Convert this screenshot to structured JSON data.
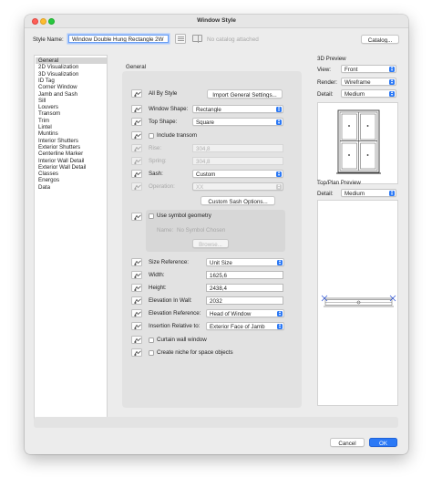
{
  "window": {
    "title": "Window Style"
  },
  "header": {
    "style_name_label": "Style Name:",
    "style_name_value": "Window Double Hung Rectangle 2W",
    "catalog_status": "No catalog attached",
    "catalog_button": "Catalog..."
  },
  "sidebar": {
    "items": [
      {
        "label": "General",
        "selected": true
      },
      {
        "label": "2D Visualization"
      },
      {
        "label": "3D Visualization"
      },
      {
        "label": "ID Tag"
      },
      {
        "label": "Corner Window"
      },
      {
        "label": "Jamb and Sash"
      },
      {
        "label": "Sill"
      },
      {
        "label": "Louvers"
      },
      {
        "label": "Transom"
      },
      {
        "label": "Trim"
      },
      {
        "label": "Lintel"
      },
      {
        "label": "Muntins"
      },
      {
        "label": "Interior Shutters"
      },
      {
        "label": "Exterior Shutters"
      },
      {
        "label": "Centerline Marker"
      },
      {
        "label": "Interior Wall Detail"
      },
      {
        "label": "Exterior Wall Detail"
      },
      {
        "label": "Classes"
      },
      {
        "label": "Energos"
      },
      {
        "label": "Data"
      }
    ]
  },
  "general": {
    "section_title": "General",
    "all_by_style_label": "All By Style",
    "import_button": "Import General Settings...",
    "window_shape_label": "Window Shape:",
    "window_shape_value": "Rectangle",
    "top_shape_label": "Top Shape:",
    "top_shape_value": "Square",
    "include_transom_label": "Include transom",
    "rise_label": "Rise:",
    "rise_value": "304,8",
    "spring_label": "Spring:",
    "spring_value": "304,8",
    "sash_label": "Sash:",
    "sash_value": "Custom",
    "operation_label": "Operation:",
    "operation_value": "XX",
    "custom_sash_button": "Custom Sash Options...",
    "use_symbol_label": "Use symbol geometry",
    "symbol_name_label": "Name:",
    "symbol_name_value": "No Symbol Chosen",
    "browse_button": "Browse...",
    "size_ref_label": "Size Reference:",
    "size_ref_value": "Unit Size",
    "width_label": "Width:",
    "width_value": "1625,6",
    "height_label": "Height:",
    "height_value": "2438,4",
    "elevation_label": "Elevation In Wall:",
    "elevation_value": "2032",
    "elevation_ref_label": "Elevation Reference:",
    "elevation_ref_value": "Head of Window",
    "insertion_label": "Insertion Relative to:",
    "insertion_value": "Exterior Face of Jamb",
    "curtain_wall_label": "Curtain wall window",
    "niche_label": "Create niche for space objects"
  },
  "preview3d": {
    "title": "3D Preview",
    "view_label": "View:",
    "view_value": "Front",
    "render_label": "Render:",
    "render_value": "Wireframe",
    "detail_label": "Detail:",
    "detail_value": "Medium"
  },
  "preview_plan": {
    "title": "Top/Plan Preview",
    "detail_label": "Detail:",
    "detail_value": "Medium"
  },
  "footer": {
    "cancel": "Cancel",
    "ok": "OK"
  },
  "colors": {
    "accent": "#2b79f6",
    "plan_marker": "#2b52d6"
  }
}
